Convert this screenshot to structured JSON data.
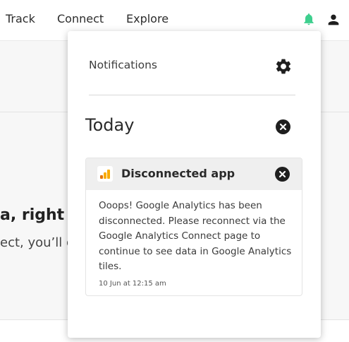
{
  "nav": {
    "links": [
      "Track",
      "Connect",
      "Explore"
    ]
  },
  "icons": {
    "bell": "bell-icon",
    "user": "user-icon",
    "gear": "gear-icon",
    "close": "close-icon",
    "analytics": "google-analytics-logo"
  },
  "colors": {
    "bell_accent": "#3ecf8e",
    "ga_orange": "#f9ab00",
    "ga_dark_orange": "#e37400"
  },
  "background": {
    "heading": "a, right he",
    "subtext": "ect, you’ll g"
  },
  "panel": {
    "title": "Notifications",
    "section_title": "Today",
    "notification": {
      "title": "Disconnected app",
      "body": "Ooops! Google Analytics has been disconnected. Please reconnect via the Google Analytics Connect page to continue to see data in Google Analytics tiles.",
      "timestamp": "10 Jun at 12:15 am"
    }
  }
}
